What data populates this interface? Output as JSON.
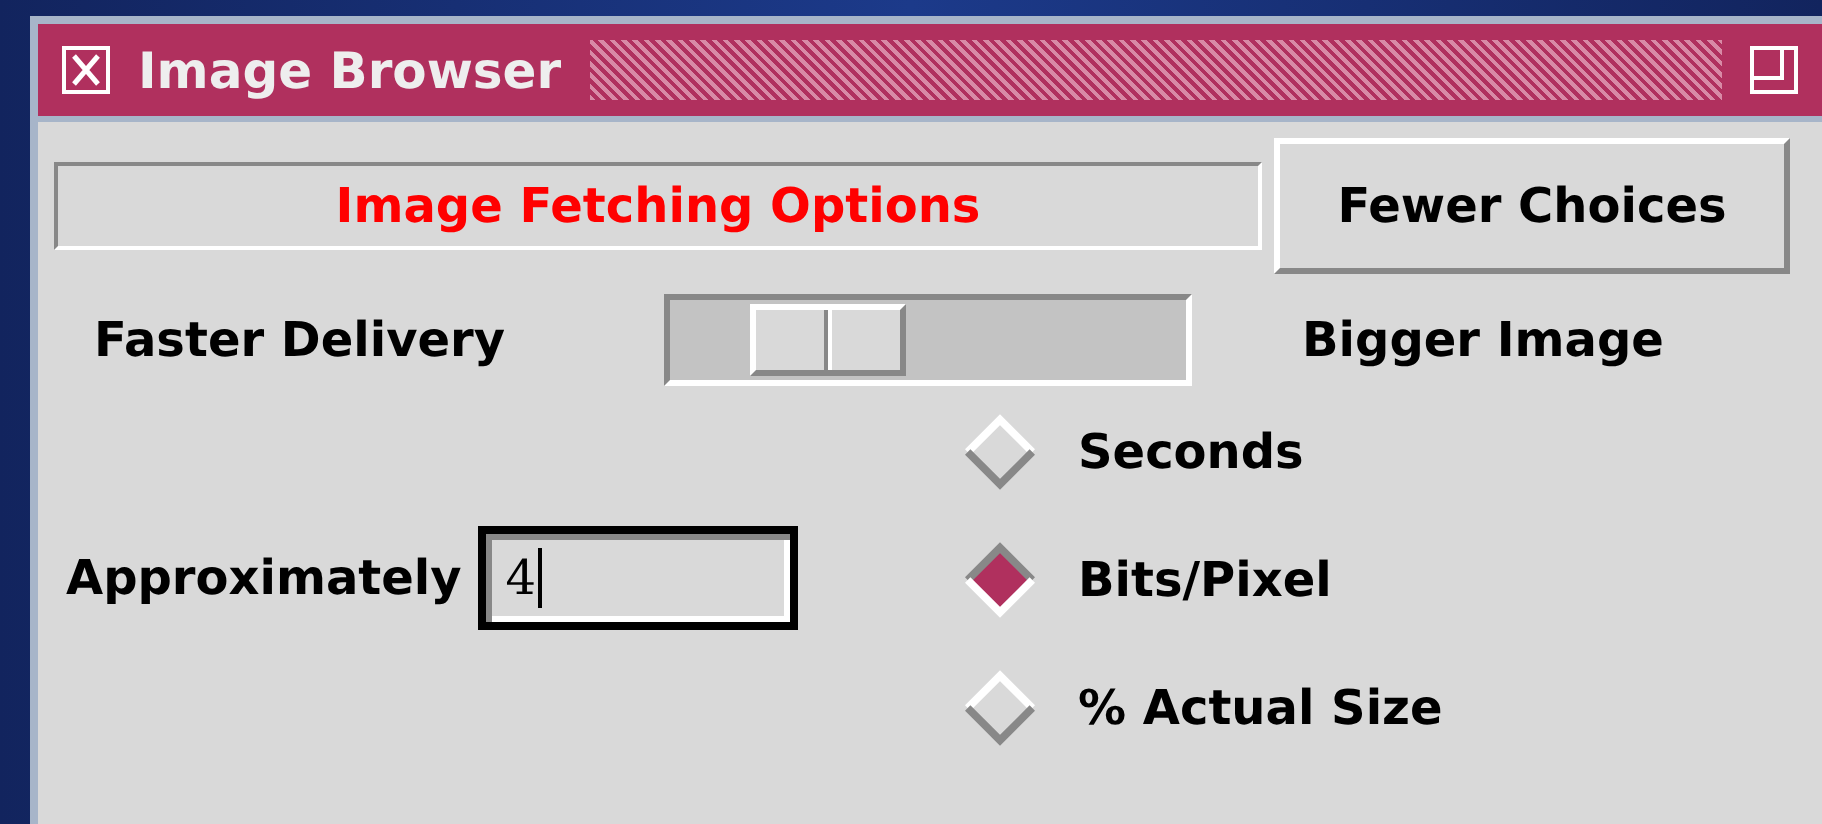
{
  "window": {
    "title": "Image Browser"
  },
  "header": {
    "label": "Image Fetching Options",
    "button": "Fewer Choices"
  },
  "slider": {
    "left_label": "Faster Delivery",
    "right_label": "Bigger Image",
    "level": 0.22
  },
  "approx": {
    "label": "Approximately",
    "value": "4"
  },
  "units": [
    {
      "label": "Seconds",
      "selected": false
    },
    {
      "label": "Bits/Pixel",
      "selected": true
    },
    {
      "label": "% Actual Size",
      "selected": false
    }
  ]
}
